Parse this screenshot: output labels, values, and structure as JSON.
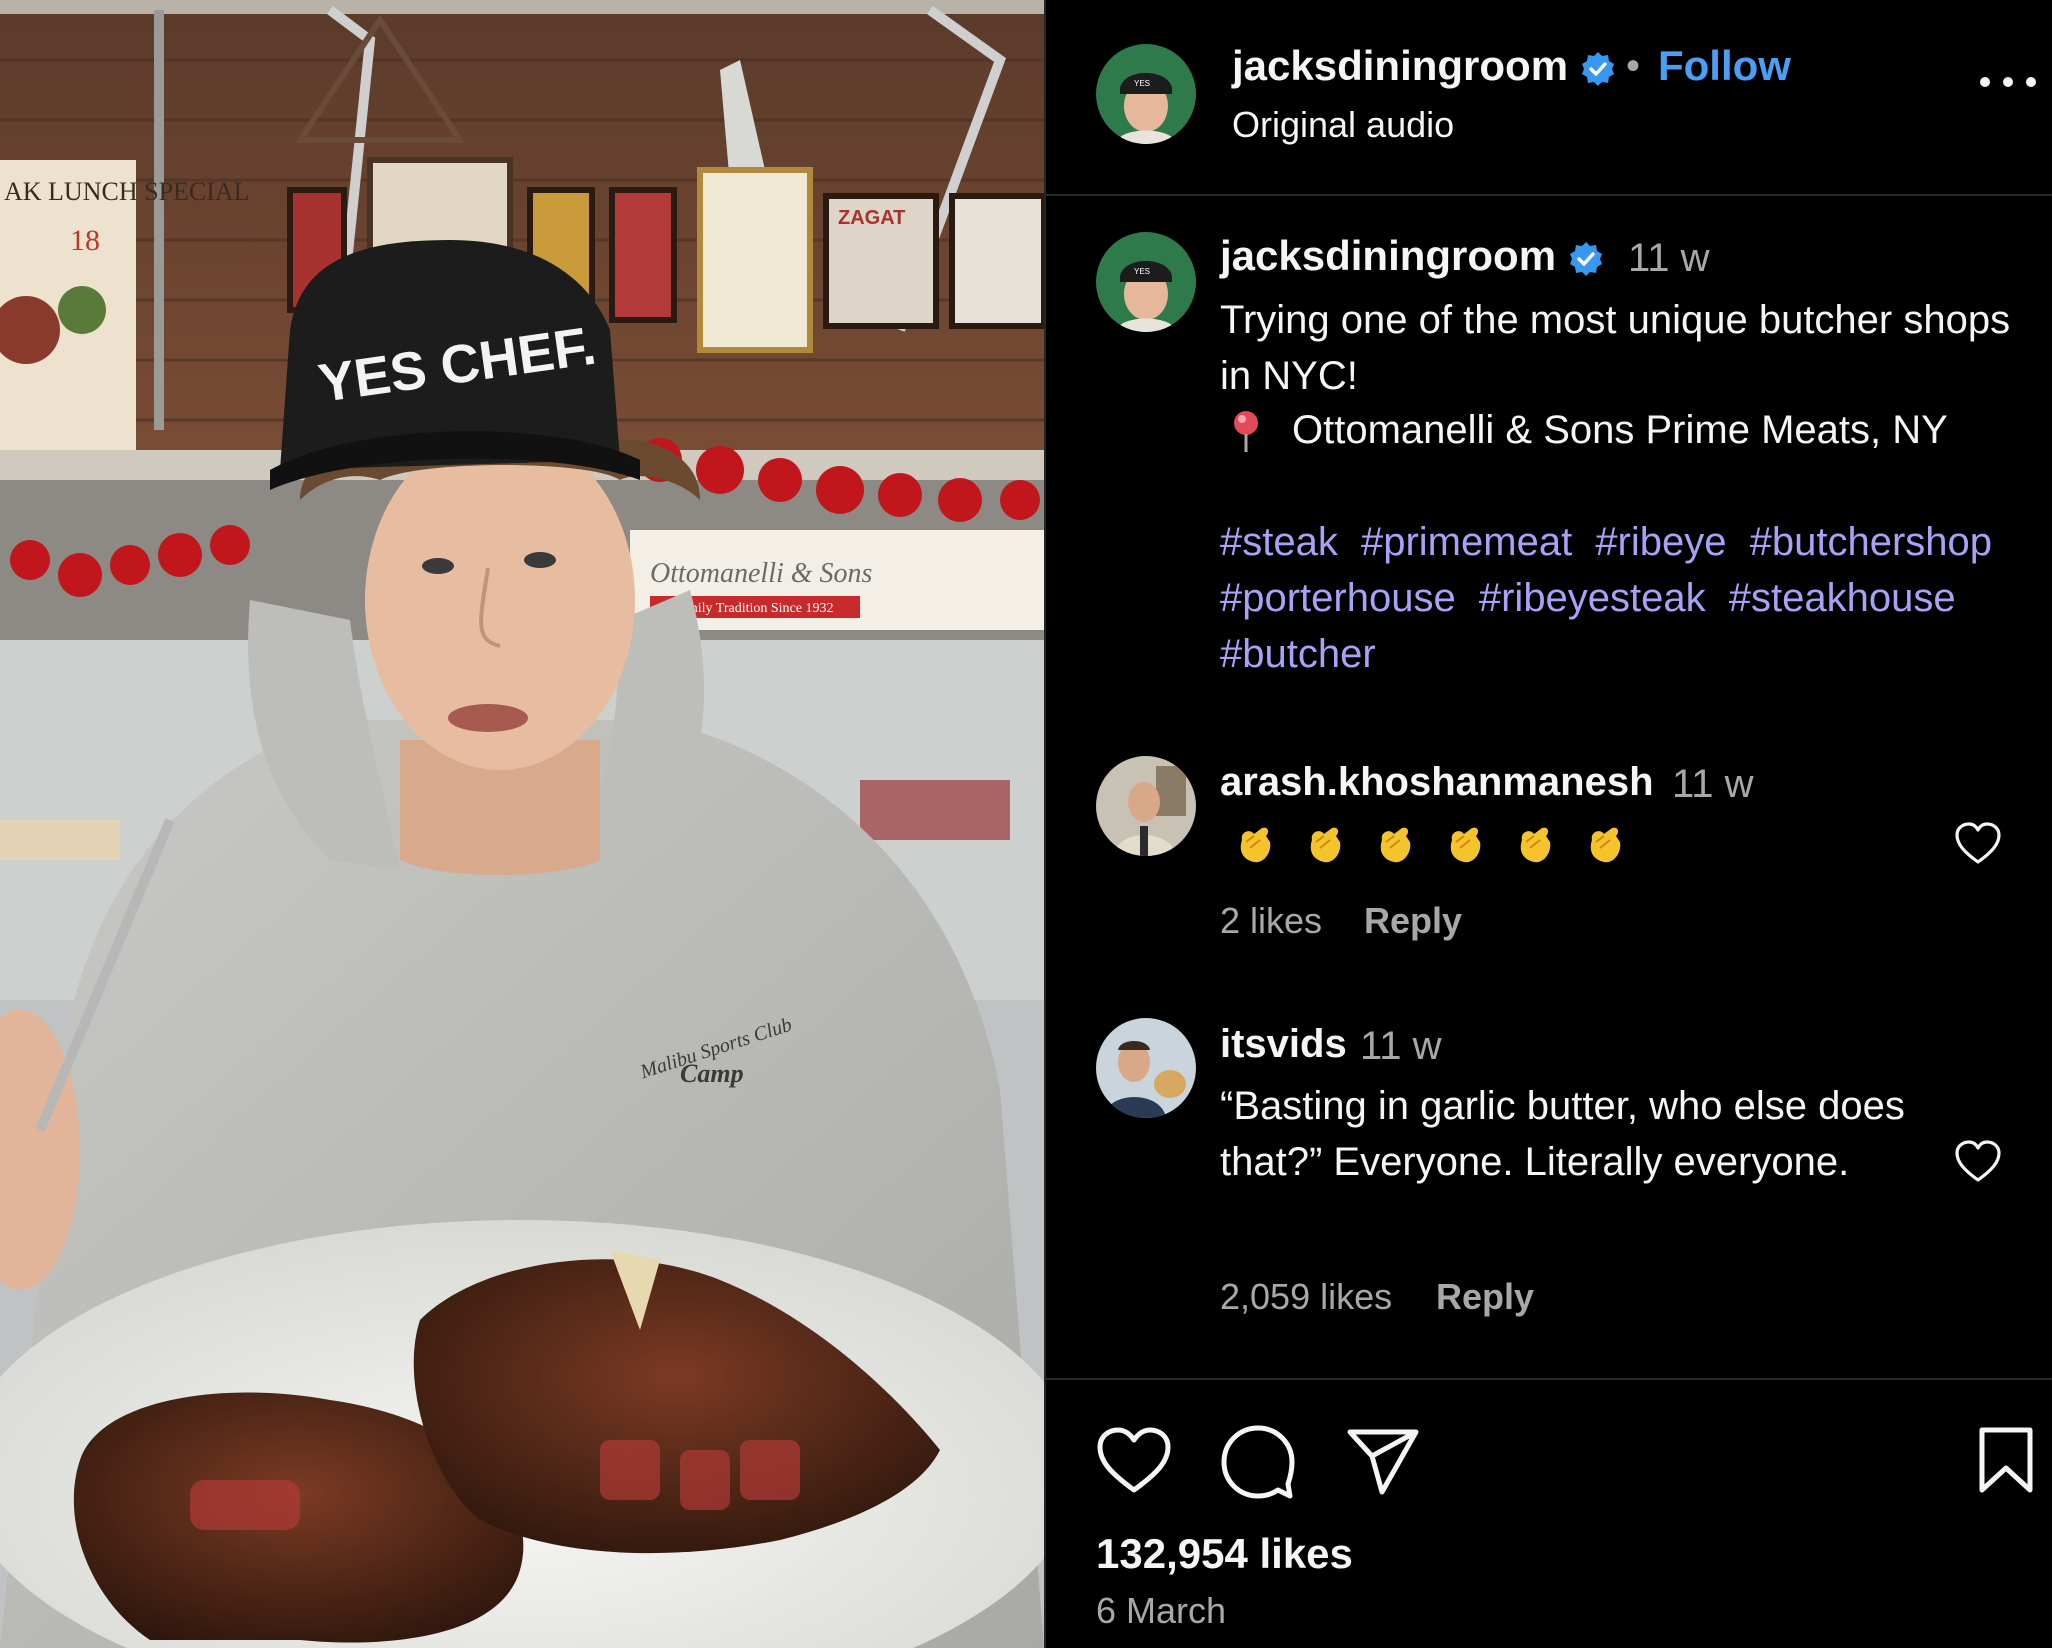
{
  "media": {
    "cap_text": "YES CHEF.",
    "sign_text": "Ottomanelli & Sons",
    "sign_subtext": "A Family Tradition Since 1932",
    "menu_board": "AK LUNCH SPECIAL",
    "menu_price": "18",
    "zagat_text": "ZAGAT",
    "hoodie_print_1": "Malibu Sports Club",
    "hoodie_print_2": "Camp"
  },
  "header": {
    "username": "jacksdiningroom",
    "follow_label": "Follow",
    "audio": "Original audio",
    "separator": "•"
  },
  "caption": {
    "username": "jacksdiningroom",
    "time": "11 w",
    "text": "Trying one of the most unique butcher shops in NYC!",
    "location": "Ottomanelli & Sons Prime Meats, NY",
    "hashtags": [
      "#steak",
      "#primemeat",
      "#ribeye",
      "#butchershop",
      "#porterhouse",
      "#ribeyesteak",
      "#steakhouse",
      "#butcher"
    ]
  },
  "comments": [
    {
      "username": "arash.khoshanmanesh",
      "time": "11 w",
      "text": "👏👏👏👏👏👏",
      "likes": "2 likes",
      "reply": "Reply"
    },
    {
      "username": "itsvids",
      "time": "11 w",
      "text": "“Basting in garlic butter, who else does that?” Everyone. Literally everyone.",
      "likes": "2,059 likes",
      "reply": "Reply"
    }
  ],
  "footer": {
    "likes": "132,954 likes",
    "date": "6 March"
  },
  "colors": {
    "accent": "#4a9ff5",
    "hashtag": "#a6a2f5",
    "muted": "#a8a8a8",
    "verified": "#3897f0"
  }
}
